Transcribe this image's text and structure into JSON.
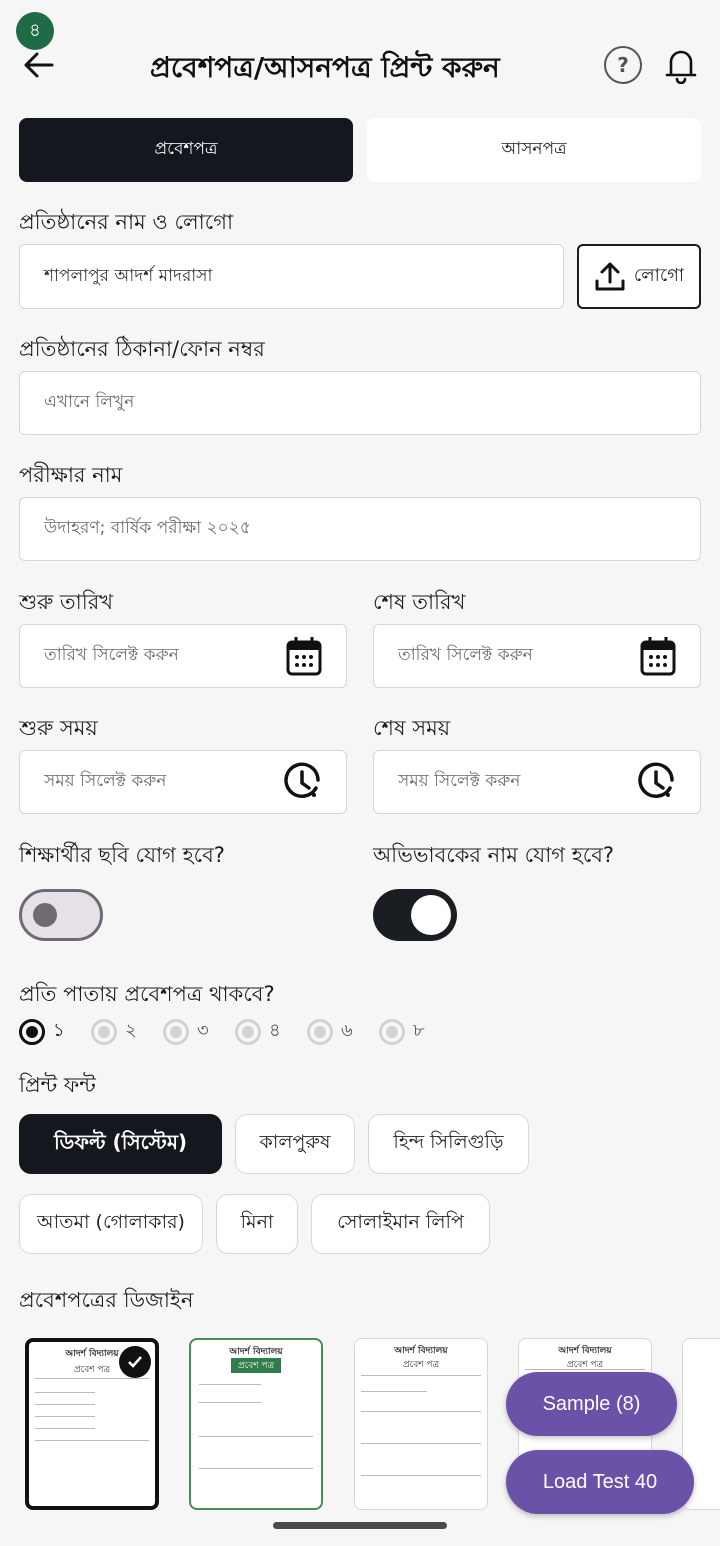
{
  "header": {
    "badge": "৪",
    "title": "প্রবেশপত্র/আসনপত্র প্রিন্ট করুন",
    "help_label": "?"
  },
  "tabs": [
    {
      "label": "প্রবেশপত্র",
      "active": true
    },
    {
      "label": "আসনপত্র",
      "active": false
    }
  ],
  "form": {
    "institution_label": "প্রতিষ্ঠানের নাম ও লোগো",
    "institution_value": "শাপলাপুর আদর্শ মাদরাসা",
    "logo_button": "লোগো",
    "address_label": "প্রতিষ্ঠানের ঠিকানা/ফোন নম্বর",
    "address_placeholder": "এখানে লিখুন",
    "exam_label": "পরীক্ষার নাম",
    "exam_placeholder": "উদাহরণ; বার্ষিক পরীক্ষা ২০২৫",
    "start_date_label": "শুরু তারিখ",
    "start_date_placeholder": "তারিখ সিলেক্ট করুন",
    "end_date_label": "শেষ তারিখ",
    "end_date_placeholder": "তারিখ সিলেক্ট করুন",
    "start_time_label": "শুরু সময়",
    "start_time_placeholder": "সময় সিলেক্ট করুন",
    "end_time_label": "শেষ সময়",
    "end_time_placeholder": "সময় সিলেক্ট করুন",
    "student_photo_label": "শিক্ষার্থীর ছবি যোগ হবে?",
    "student_photo_on": false,
    "guardian_label": "অভিভাবকের নাম যোগ হবে?",
    "guardian_on": true,
    "per_page_label": "প্রতি পাতায় প্রবেশপত্র থাকবে?",
    "per_page_options": [
      "১",
      "২",
      "৩",
      "৪",
      "৬",
      "৮"
    ],
    "per_page_selected": "১",
    "font_label": "প্রিন্ট ফন্ট",
    "fonts": [
      "ডিফল্ট (সিস্টেম)",
      "কালপুরুষ",
      "হিন্দ সিলিগুড়ি",
      "আতমা (গোলাকার)",
      "মিনা",
      "সোলাইমান লিপি"
    ],
    "font_selected": "ডিফল্ট (সিস্টেম)",
    "design_label": "প্রবেশপত্রের ডিজাইন"
  },
  "thumbnails": [
    {
      "title": "আদর্শ বিদ্যালয়",
      "subtitle": "প্রবেশ পত্র",
      "selected": true
    },
    {
      "title": "আদর্শ বিদ্যালয়",
      "subtitle": "প্রবেশ পত্র",
      "selected": false
    },
    {
      "title": "আদর্শ বিদ্যালয়",
      "subtitle": "প্রবেশ পত্র",
      "selected": false
    },
    {
      "title": "আদর্শ বিদ্যালয়",
      "subtitle": "প্রবেশ পত্র",
      "selected": false
    }
  ],
  "fabs": {
    "sample": "Sample (8)",
    "load_test": "Load Test 40"
  },
  "colors": {
    "accent_dark": "#14181e",
    "badge_green": "#1f6b45",
    "fab_purple": "#6a52a8"
  }
}
